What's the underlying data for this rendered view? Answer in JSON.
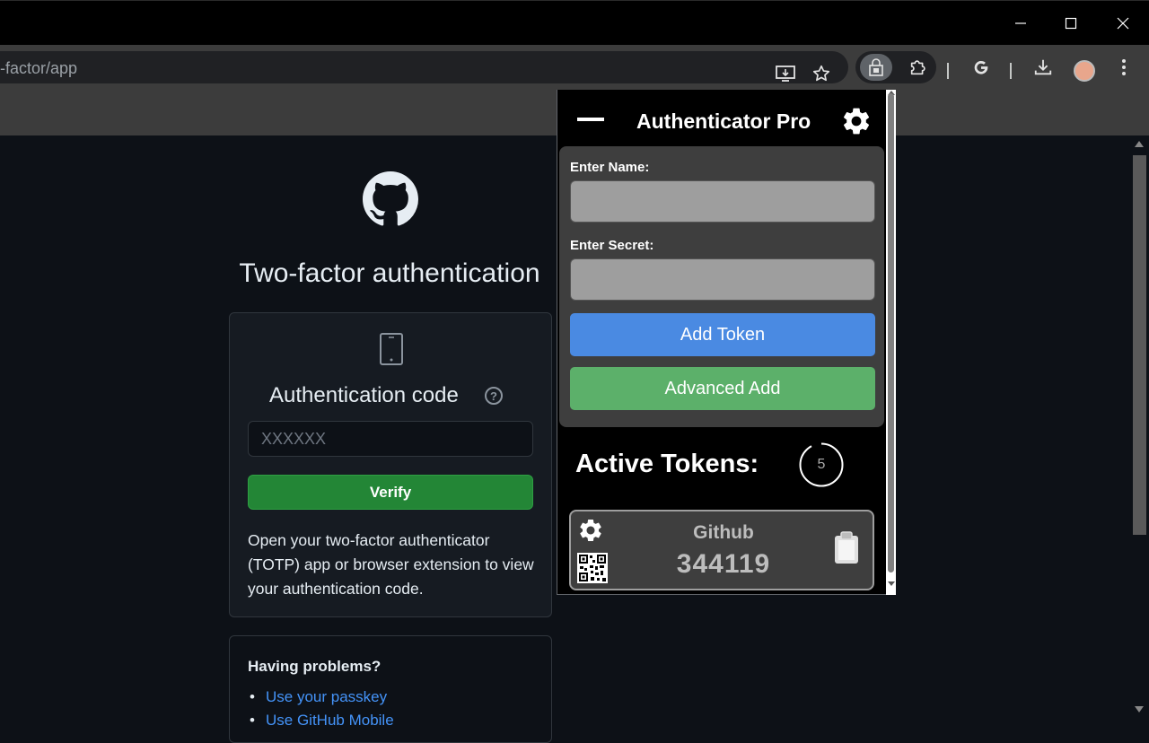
{
  "browser": {
    "url_fragment": "-factor/app"
  },
  "page": {
    "title": "Two-factor authentication",
    "auth_code_label": "Authentication code",
    "help_glyph": "?",
    "code_placeholder": "XXXXXX",
    "verify_label": "Verify",
    "description": "Open your two-factor authenticator (TOTP) app or browser extension to view your authentication code.",
    "problems_title": "Having problems?",
    "problem_links": [
      "Use your passkey",
      "Use GitHub Mobile"
    ]
  },
  "popup": {
    "title": "Authenticator Pro",
    "name_label": "Enter Name:",
    "name_value": "",
    "secret_label": "Enter Secret:",
    "secret_value": "",
    "add_button": "Add Token",
    "advanced_button": "Advanced Add",
    "active_tokens_label": "Active Tokens:",
    "timer_seconds": "5",
    "tokens": [
      {
        "name": "Github",
        "code": "344119"
      }
    ]
  },
  "colors": {
    "verify_green": "#238636",
    "add_blue": "#4a8ae2",
    "advanced_green": "#5cb06a",
    "link_blue": "#4493f8"
  }
}
